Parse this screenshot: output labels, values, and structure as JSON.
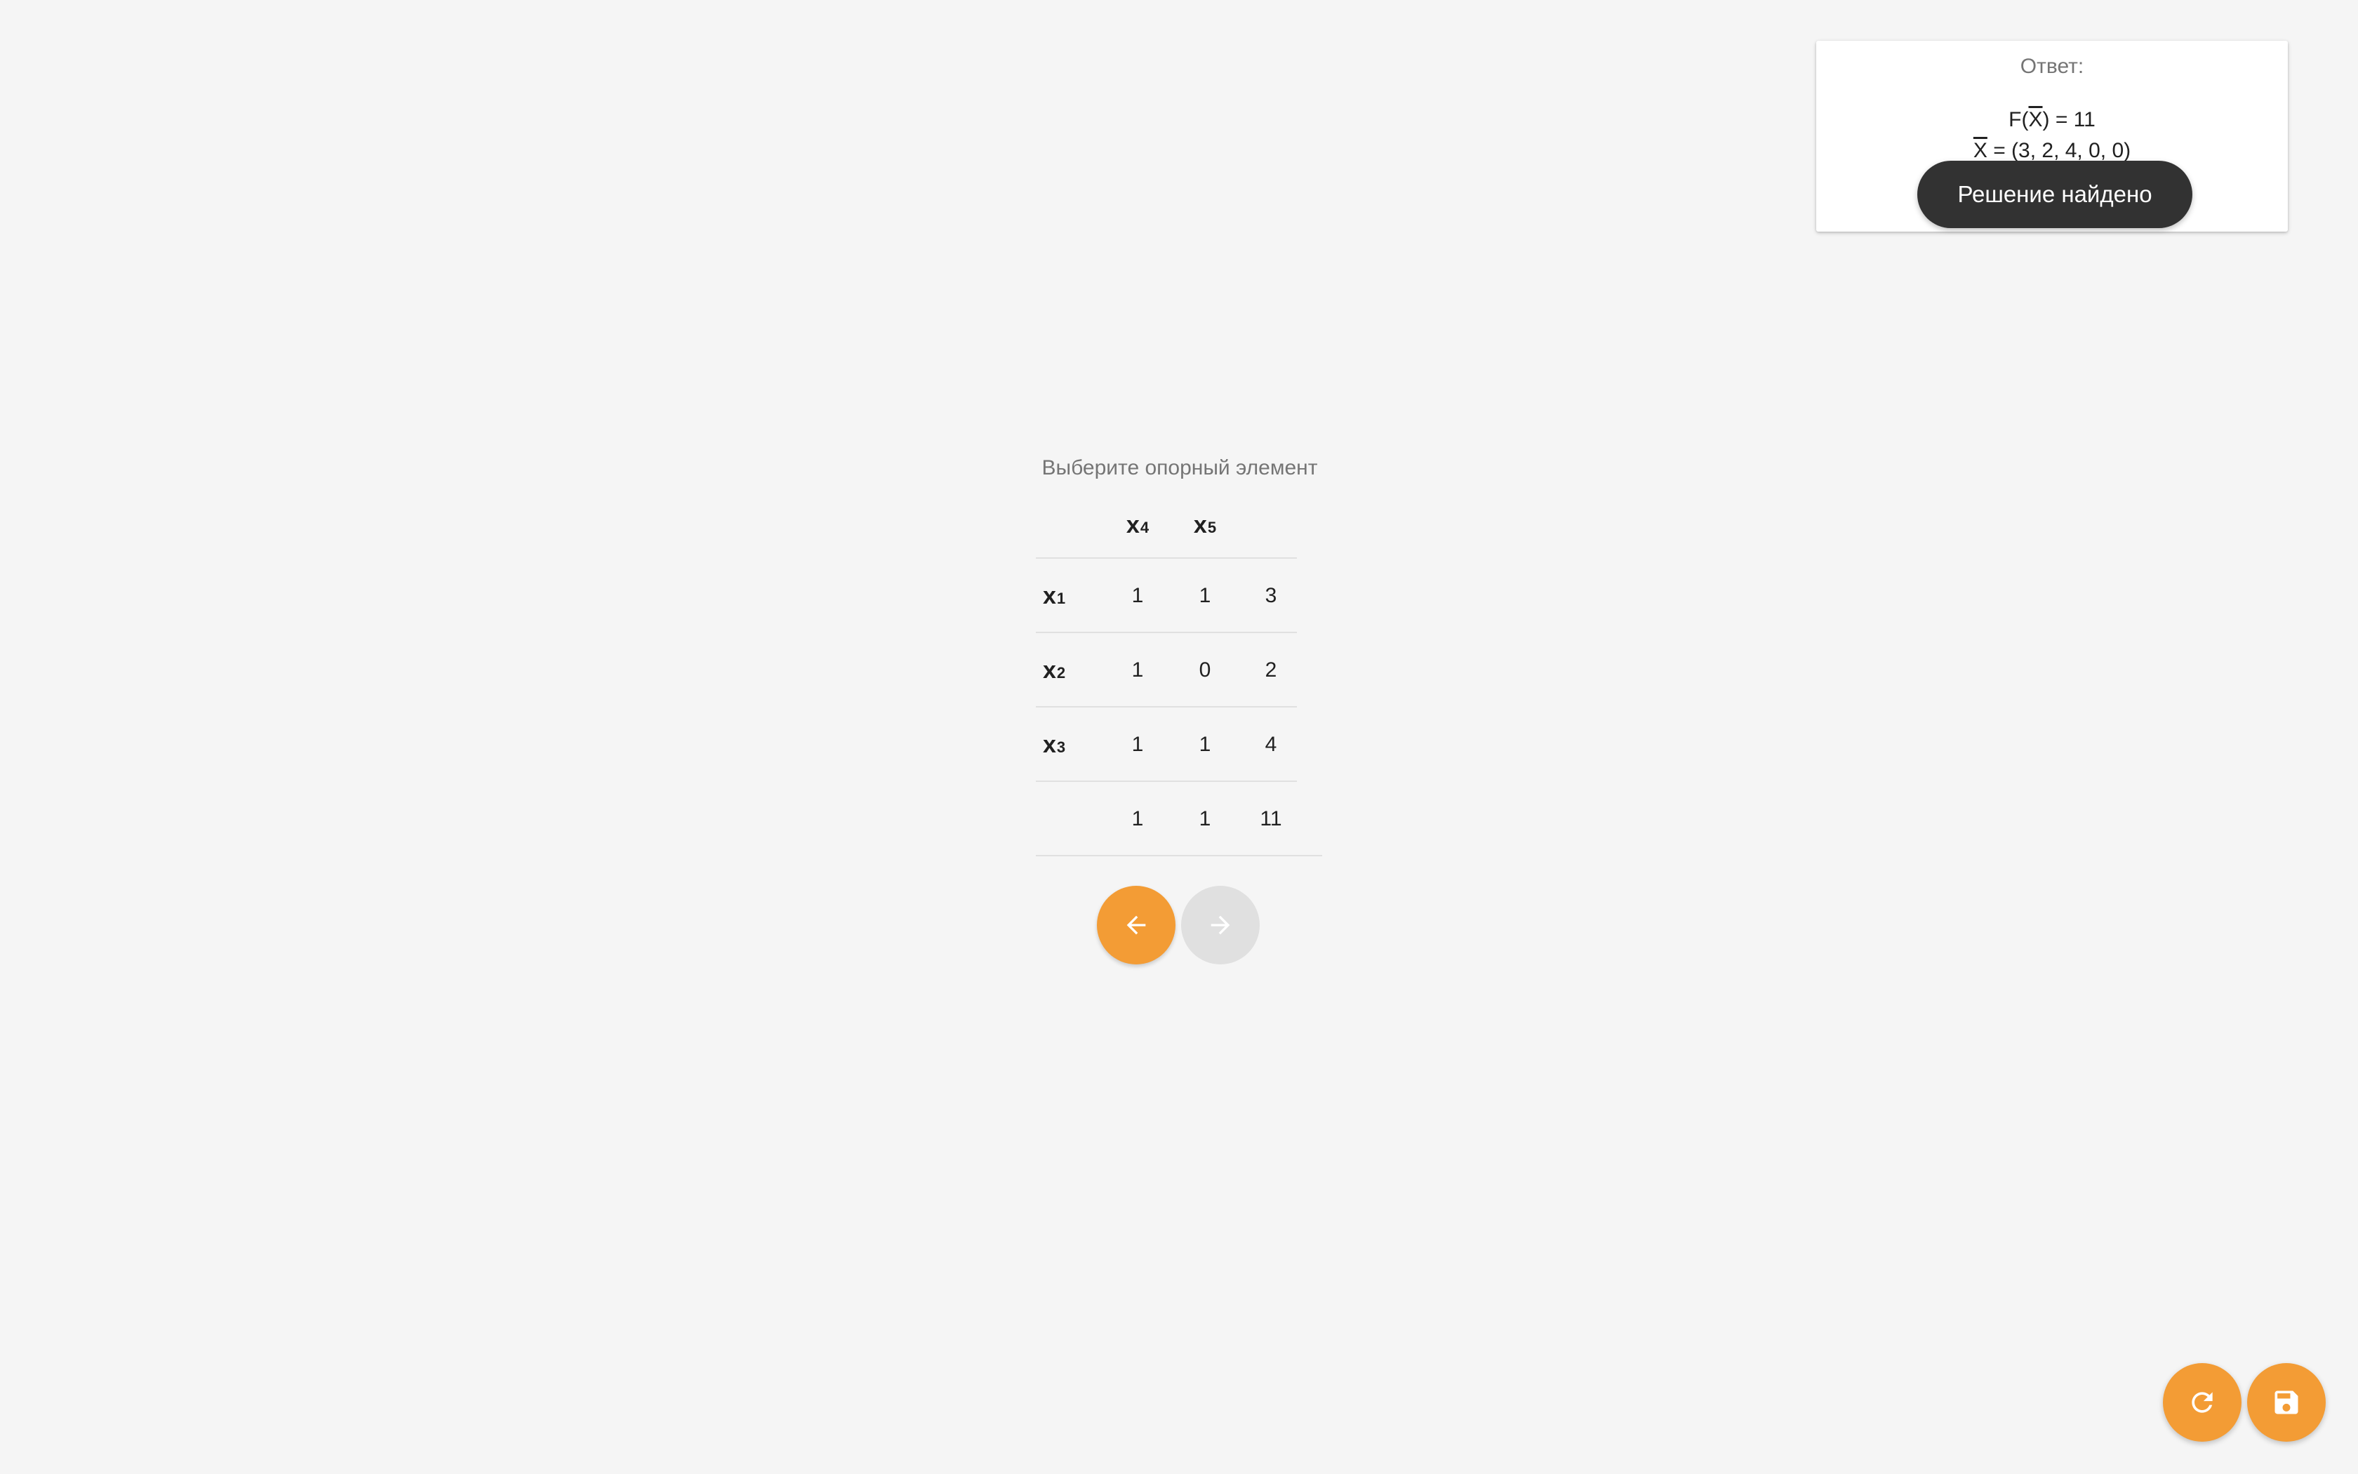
{
  "answer": {
    "title": "Ответ:",
    "f_prefix": "F(",
    "f_var": "X",
    "f_suffix": ") = 11",
    "x_var": "X",
    "x_value": " = (3, 2, 4, 0, 0)"
  },
  "toast": {
    "message": "Решение найдено"
  },
  "prompt": "Выберите опорный элемент",
  "table": {
    "headers": [
      {
        "label": "x",
        "sub": "4"
      },
      {
        "label": "x",
        "sub": "5"
      }
    ],
    "rows": [
      {
        "var": {
          "label": "x",
          "sub": "1"
        },
        "cells": [
          "1",
          "1"
        ],
        "rhs": "3"
      },
      {
        "var": {
          "label": "x",
          "sub": "2"
        },
        "cells": [
          "1",
          "0"
        ],
        "rhs": "2"
      },
      {
        "var": {
          "label": "x",
          "sub": "3"
        },
        "cells": [
          "1",
          "1"
        ],
        "rhs": "4"
      }
    ],
    "totals": {
      "cells": [
        "1",
        "1"
      ],
      "rhs": "11"
    }
  },
  "icons": {
    "prev": "arrow-left-icon",
    "next": "arrow-right-icon",
    "refresh": "refresh-icon",
    "save": "save-icon"
  },
  "colors": {
    "accent": "#f39c35",
    "disabled": "#e0e0e0",
    "toast_bg": "#323232",
    "background": "#f5f5f5"
  }
}
